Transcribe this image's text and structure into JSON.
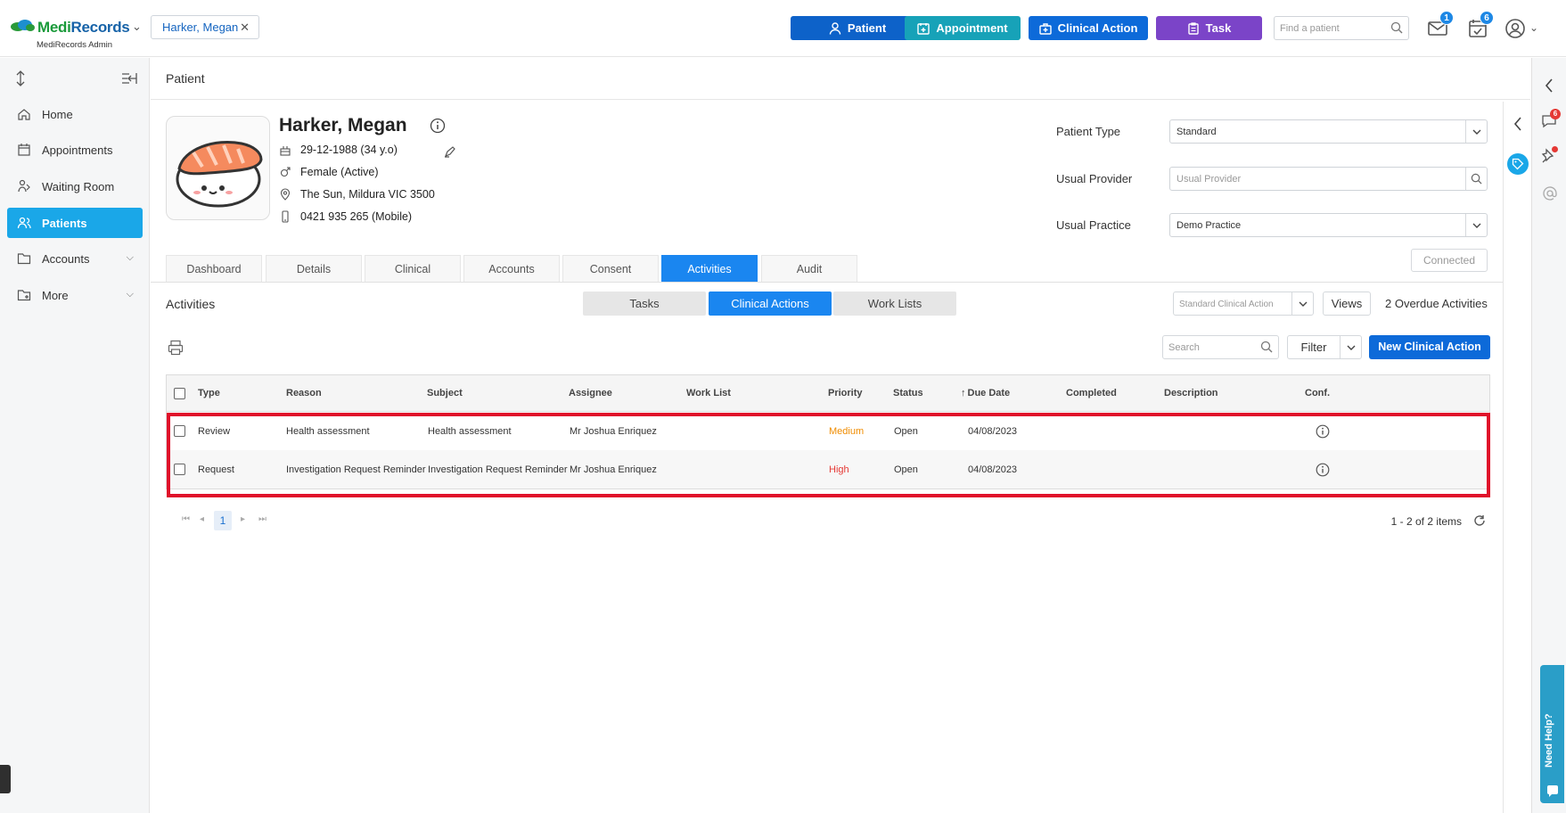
{
  "app": {
    "brand_a": "Medi",
    "brand_b": "Records",
    "sub": "MediRecords Admin",
    "open_patient": "Harker, Megan"
  },
  "toolbar": {
    "patient": "Patient",
    "appointment": "Appointment",
    "clinical_action": "Clinical Action",
    "task": "Task",
    "find_placeholder": "Find a patient",
    "mail_count": "1",
    "tasks_count": "6"
  },
  "sidebar": {
    "items": [
      {
        "label": "Home",
        "icon": "home-icon"
      },
      {
        "label": "Appointments",
        "icon": "calendar-icon"
      },
      {
        "label": "Waiting Room",
        "icon": "waiting-room-icon"
      },
      {
        "label": "Patients",
        "icon": "patients-icon"
      },
      {
        "label": "Accounts",
        "icon": "folder-icon"
      },
      {
        "label": "More",
        "icon": "more-icon"
      }
    ]
  },
  "page": {
    "title": "Patient"
  },
  "patient": {
    "name": "Harker, Megan",
    "dob": "29-12-1988 (34 y.o)",
    "gender": "Female (Active)",
    "address": "The Sun, Mildura VIC 3500",
    "phone": "0421 935 265 (Mobile)"
  },
  "fields": {
    "patient_type_label": "Patient Type",
    "patient_type_value": "Standard",
    "usual_provider_label": "Usual Provider",
    "usual_provider_placeholder": "Usual Provider",
    "usual_practice_label": "Usual Practice",
    "usual_practice_value": "Demo Practice",
    "connected": "Connected"
  },
  "tabs": [
    "Dashboard",
    "Details",
    "Clinical",
    "Accounts",
    "Consent",
    "Activities",
    "Audit"
  ],
  "activities": {
    "title": "Activities",
    "segments": [
      "Tasks",
      "Clinical Actions",
      "Work Lists"
    ],
    "view_placeholder": "Standard Clinical Action",
    "views": "Views",
    "overdue": "2 Overdue Activities",
    "search_placeholder": "Search",
    "filter": "Filter",
    "new_button": "New Clinical Action"
  },
  "table": {
    "columns": [
      "Type",
      "Reason",
      "Subject",
      "Assignee",
      "Work List",
      "Priority",
      "Status",
      "Due Date",
      "Completed",
      "Description",
      "Conf."
    ],
    "rows": [
      {
        "type": "Review",
        "reason": "Health assessment",
        "subject": "Health assessment",
        "assignee": "Mr Joshua Enriquez",
        "work_list": "",
        "priority": "Medium",
        "status": "Open",
        "due": "04/08/2023",
        "completed": "",
        "description": ""
      },
      {
        "type": "Request",
        "reason": "Investigation Request Reminder",
        "subject": "Investigation Request Reminder",
        "assignee": "Mr Joshua Enriquez",
        "work_list": "",
        "priority": "High",
        "status": "Open",
        "due": "04/08/2023",
        "completed": "",
        "description": ""
      }
    ]
  },
  "pager": {
    "page": "1",
    "count": "1 - 2 of 2 items"
  },
  "help": {
    "label": "Need Help?"
  },
  "rail": {
    "chat_count": "6"
  },
  "colors": {
    "primary": "#0d62c9",
    "appointment": "#17a2b8",
    "task": "#7b44c8",
    "sidebar_active": "#1aa7e8",
    "highlight": "#e0102a",
    "priority_medium": "#f08c00",
    "priority_high": "#e53935"
  }
}
